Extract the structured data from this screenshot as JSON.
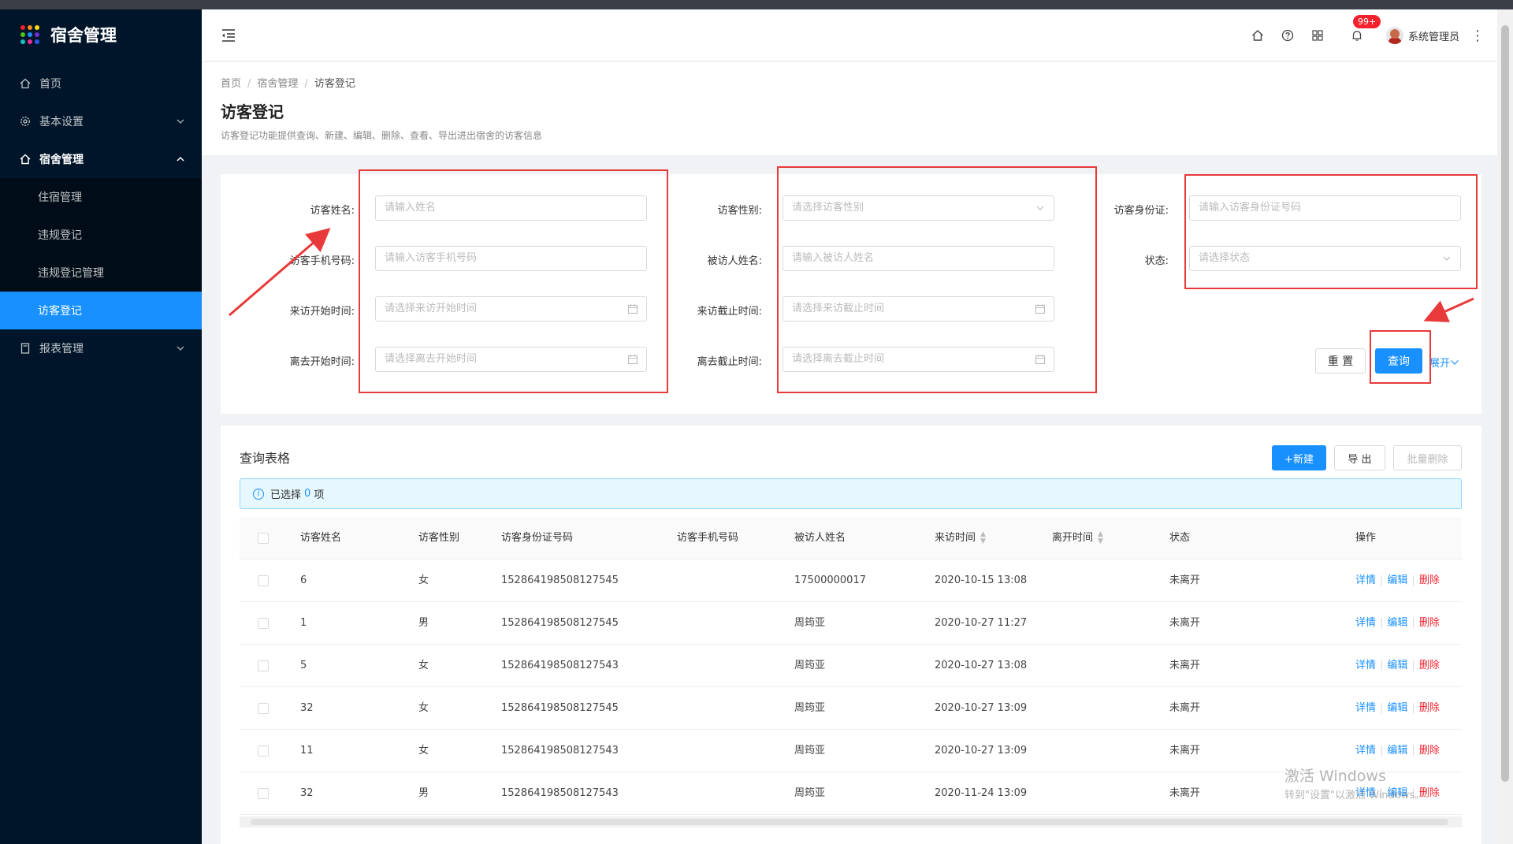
{
  "app": {
    "title": "宿舍管理"
  },
  "sidebar": {
    "items": [
      {
        "label": "首页",
        "icon": "home-icon"
      },
      {
        "label": "基本设置",
        "icon": "gear-icon"
      },
      {
        "label": "宿舍管理",
        "icon": "home-icon",
        "open": true
      },
      {
        "label": "报表管理",
        "icon": "file-icon"
      }
    ],
    "sub": [
      {
        "label": "住宿管理"
      },
      {
        "label": "违规登记"
      },
      {
        "label": "违规登记管理"
      },
      {
        "label": "访客登记",
        "active": true
      }
    ]
  },
  "header": {
    "badge": "99+",
    "user": "系统管理员"
  },
  "breadcrumb": [
    "首页",
    "宿舍管理",
    "访客登记"
  ],
  "page": {
    "title": "访客登记",
    "description": "访客登记功能提供查询、新建、编辑、删除、查看、导出进出宿舍的访客信息"
  },
  "filters": {
    "visitor_name": {
      "label": "访客姓名:",
      "placeholder": "请输入姓名"
    },
    "visitor_gender": {
      "label": "访客性别:",
      "placeholder": "请选择访客性别"
    },
    "visitor_id": {
      "label": "访客身份证:",
      "placeholder": "请输入访客身份证号码"
    },
    "visitor_phone": {
      "label": "访客手机号码:",
      "placeholder": "请输入访客手机号码"
    },
    "visited_name": {
      "label": "被访人姓名:",
      "placeholder": "请输入被访人姓名"
    },
    "status": {
      "label": "状态:",
      "placeholder": "请选择状态"
    },
    "visit_start": {
      "label": "来访开始时间:",
      "placeholder": "请选择来访开始时间"
    },
    "visit_end": {
      "label": "来访截止时间:",
      "placeholder": "请选择来访截止时间"
    },
    "leave_start": {
      "label": "离去开始时间:",
      "placeholder": "请选择离去开始时间"
    },
    "leave_end": {
      "label": "离去截止时间:",
      "placeholder": "请选择离去截止时间"
    },
    "reset": "重 置",
    "query": "查询",
    "expand": "展开"
  },
  "table": {
    "title": "查询表格",
    "new": "+新建",
    "export": "导 出",
    "batch_delete": "批量删除",
    "selected_prefix": "已选择",
    "selected_count": "0",
    "selected_suffix": "项",
    "columns": [
      "访客姓名",
      "访客性别",
      "访客身份证号码",
      "访客手机号码",
      "被访人姓名",
      "来访时间",
      "离开时间",
      "状态",
      "操作"
    ],
    "rows": [
      {
        "name": "6",
        "gender": "女",
        "id": "152864198508127545",
        "phone": "",
        "visited": "17500000017",
        "visit_time": "2020-10-15 13:08",
        "leave_time": "",
        "status": "未离开"
      },
      {
        "name": "1",
        "gender": "男",
        "id": "152864198508127545",
        "phone": "",
        "visited": "周筠亚",
        "visit_time": "2020-10-27 11:27",
        "leave_time": "",
        "status": "未离开"
      },
      {
        "name": "5",
        "gender": "女",
        "id": "152864198508127543",
        "phone": "",
        "visited": "周筠亚",
        "visit_time": "2020-10-27 13:08",
        "leave_time": "",
        "status": "未离开"
      },
      {
        "name": "32",
        "gender": "女",
        "id": "152864198508127545",
        "phone": "",
        "visited": "周筠亚",
        "visit_time": "2020-10-27 13:09",
        "leave_time": "",
        "status": "未离开"
      },
      {
        "name": "11",
        "gender": "女",
        "id": "152864198508127543",
        "phone": "",
        "visited": "周筠亚",
        "visit_time": "2020-10-27 13:09",
        "leave_time": "",
        "status": "未离开"
      },
      {
        "name": "32",
        "gender": "男",
        "id": "152864198508127543",
        "phone": "",
        "visited": "周筠亚",
        "visit_time": "2020-11-24 13:09",
        "leave_time": "",
        "status": "未离开"
      }
    ],
    "ops": {
      "detail": "详情",
      "edit": "编辑",
      "delete": "删除"
    }
  },
  "watermark": {
    "line1": "激活 Windows",
    "line2": "转到\"设置\"以激活 Windows。"
  },
  "colors": {
    "sidebar": "#001529",
    "primary": "#1890ff",
    "danger": "#f5222d",
    "annotation": "#e83a3a"
  }
}
